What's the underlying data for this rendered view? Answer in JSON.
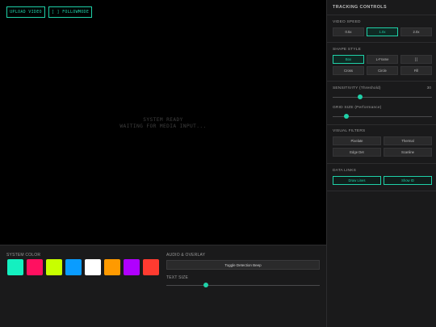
{
  "video": {
    "upload_label": "UPLOAD VIDEO",
    "follow_label": "[ ] FOLLOWMODE",
    "status_line1": "SYSTEM READY",
    "status_line2": "WAITING FOR MEDIA INPUT..."
  },
  "bottom": {
    "system_color_label": "SYSTEM COLOR",
    "colors": [
      "#14f0c0",
      "#ff1060",
      "#c8ff00",
      "#0a9cff",
      "#ffffff",
      "#ff9a00",
      "#b000ff",
      "#ff3b30"
    ],
    "audio_label": "AUDIO & OVERLAY",
    "toggle_delay_label": "Toggle Detection Beep",
    "text_size_label": "TEXT SIZE",
    "text_size_value": 0.26
  },
  "sidebar": {
    "title": "TRACKING CONTROLS",
    "video_speed_label": "VIDEO SPEED",
    "speeds": [
      "0.5x",
      "1.0x",
      "2.0x"
    ],
    "active_speed": 1,
    "shape_style_label": "SHAPE STYLE",
    "shapes": [
      "Box",
      "L-Frame",
      "[ ]",
      "Cross",
      "Circle",
      "Fill"
    ],
    "active_shape": 0,
    "sensitivity_label": "SENSITIVITY (Threshold)",
    "sensitivity_value": "30",
    "sensitivity_fraction": 0.28,
    "grid_size_label": "GRID SIZE (Performance)",
    "grid_fraction": 0.14,
    "visual_filters_label": "VISUAL FILTERS",
    "filters": [
      "Pixelate",
      "Thermal",
      "Edge Det",
      "Scanline"
    ],
    "data_links_label": "DATA LINKS",
    "links": [
      "Draw Lines",
      "Show ID"
    ]
  },
  "colors": {
    "accent": "#1fd1a8",
    "panel": "#1a1a1b",
    "video_bg": "#000000"
  }
}
